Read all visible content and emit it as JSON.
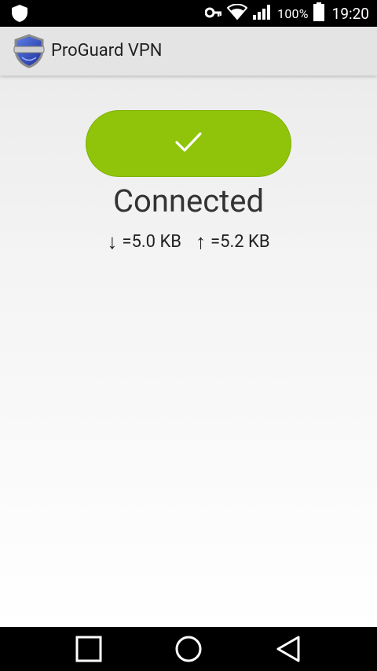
{
  "status_bar": {
    "battery_percent": "100%",
    "time": "19:20",
    "icons": [
      "shield-icon",
      "vpn-key-icon",
      "wifi-icon",
      "signal-icon",
      "battery-icon"
    ]
  },
  "app_bar": {
    "title": "ProGuard VPN",
    "logo_icon": "proguard-shield-logo"
  },
  "main": {
    "connect_button_icon": "checkmark-icon",
    "button_color": "#8fc40a",
    "status": "Connected",
    "download": {
      "arrow": "↓",
      "value": "=5.0 KB"
    },
    "upload": {
      "arrow": "↑",
      "value": "=5.2 KB"
    }
  },
  "nav_bar": {
    "buttons": [
      "recents-button",
      "home-button",
      "back-button"
    ]
  }
}
